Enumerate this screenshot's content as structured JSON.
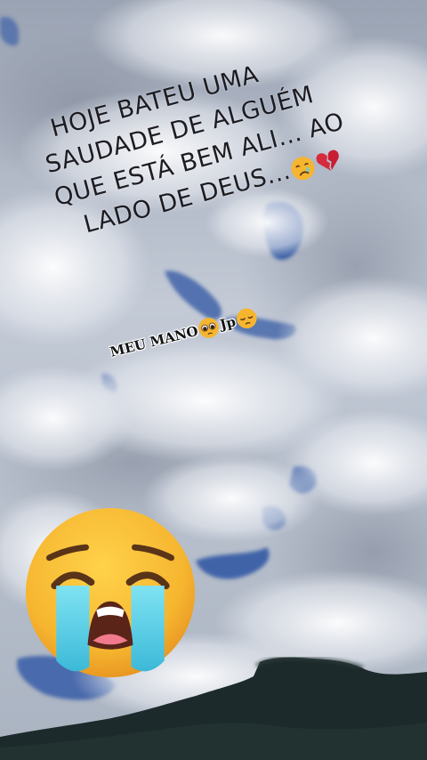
{
  "caption": {
    "line1": "HOJE BATEU UMA",
    "line2": "SAUDADE DE ALGUÉM",
    "line3": "QUE ESTÁ BEM ALI... AO",
    "line4": "LADO DE DEUS...",
    "emojis": [
      "crying-face",
      "broken-heart"
    ]
  },
  "tag": {
    "part1": "MEU MANO",
    "part2": "Jp",
    "emojis": [
      "pleading-face",
      "pensive-face"
    ]
  },
  "large_emoji": "loudly-crying-face",
  "colors": {
    "sky": "#b9c2cf",
    "blue_sky": "#3f63a8",
    "mountain": "#1d2a2c",
    "emoji_yellow": "#f6b52f",
    "tears": "#5ad2e8"
  }
}
